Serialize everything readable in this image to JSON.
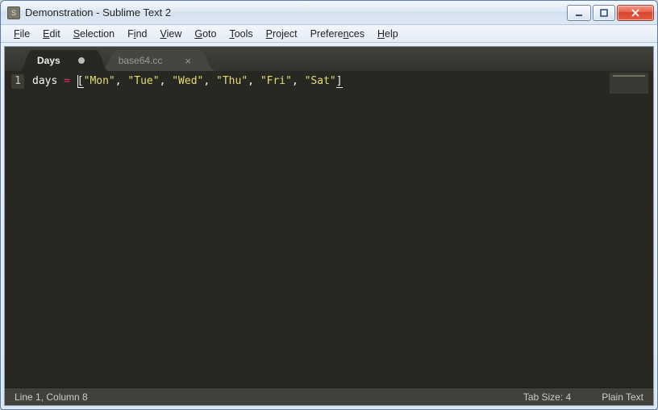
{
  "window": {
    "title": "Demonstration - Sublime Text 2"
  },
  "menubar": {
    "items": [
      {
        "label": "File",
        "accel": "F"
      },
      {
        "label": "Edit",
        "accel": "E"
      },
      {
        "label": "Selection",
        "accel": "S"
      },
      {
        "label": "Find",
        "accel": "i"
      },
      {
        "label": "View",
        "accel": "V"
      },
      {
        "label": "Goto",
        "accel": "G"
      },
      {
        "label": "Tools",
        "accel": "T"
      },
      {
        "label": "Project",
        "accel": "P"
      },
      {
        "label": "Preferences",
        "accel": "n"
      },
      {
        "label": "Help",
        "accel": "H"
      }
    ]
  },
  "tabs": [
    {
      "label": "Days",
      "active": true,
      "dirty": true
    },
    {
      "label": "base64.cc",
      "active": false,
      "dirty": false
    }
  ],
  "editor": {
    "lines": [
      {
        "n": "1",
        "tokens": [
          {
            "t": "days",
            "c": "var"
          },
          {
            "t": " ",
            "c": "punc"
          },
          {
            "t": "=",
            "c": "op"
          },
          {
            "t": " ",
            "c": "punc"
          },
          {
            "t": "",
            "c": "caret"
          },
          {
            "t": "[",
            "c": "punc-ul"
          },
          {
            "t": "\"Mon\"",
            "c": "str"
          },
          {
            "t": ", ",
            "c": "punc"
          },
          {
            "t": "\"Tue\"",
            "c": "str"
          },
          {
            "t": ", ",
            "c": "punc"
          },
          {
            "t": "\"Wed\"",
            "c": "str"
          },
          {
            "t": ", ",
            "c": "punc"
          },
          {
            "t": "\"Thu\"",
            "c": "str"
          },
          {
            "t": ", ",
            "c": "punc"
          },
          {
            "t": "\"Fri\"",
            "c": "str"
          },
          {
            "t": ", ",
            "c": "punc"
          },
          {
            "t": "\"Sat\"",
            "c": "str"
          },
          {
            "t": "]",
            "c": "punc-ul"
          }
        ]
      }
    ]
  },
  "statusbar": {
    "position": "Line 1, Column 8",
    "tabsize": "Tab Size: 4",
    "syntax": "Plain Text"
  }
}
